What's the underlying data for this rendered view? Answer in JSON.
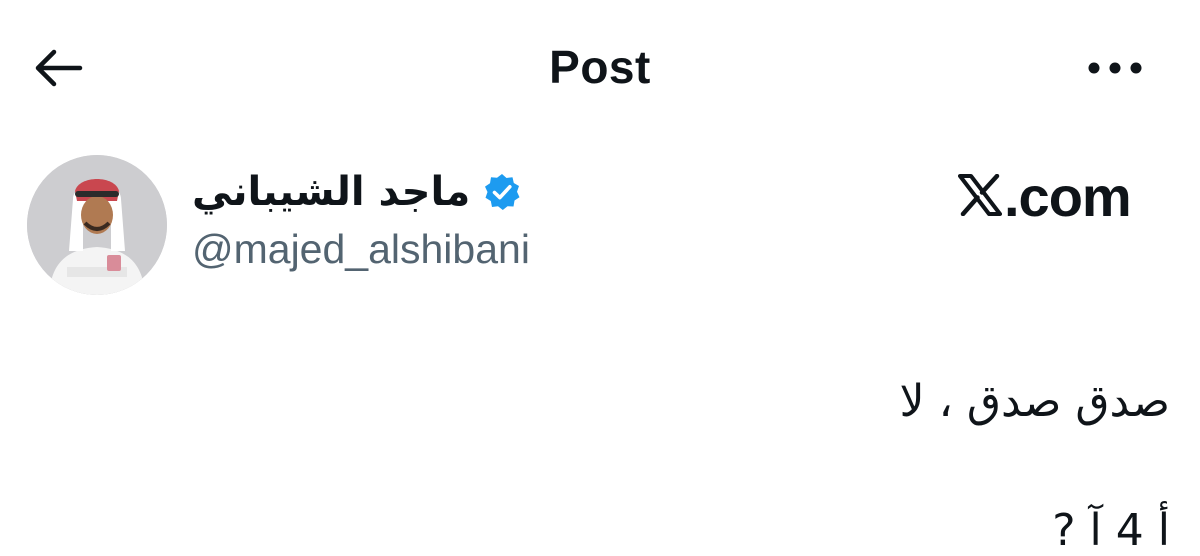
{
  "header": {
    "title": "Post"
  },
  "author": {
    "display_name": "ماجد الشيباني",
    "handle": "@majed_alshibani",
    "verified": true
  },
  "watermark": {
    "text": ".com"
  },
  "post": {
    "line1": "صدق صدق ، لا",
    "line2": "أ   4   آ    ?"
  },
  "colors": {
    "text": "#0f1419",
    "secondary": "#536471",
    "verified_badge": "#1d9bf0",
    "background": "#ffffff"
  },
  "icons": {
    "back": "back-arrow-icon",
    "more": "more-horizontal-icon",
    "verified": "verified-badge-icon",
    "x_logo": "x-logo-icon"
  }
}
